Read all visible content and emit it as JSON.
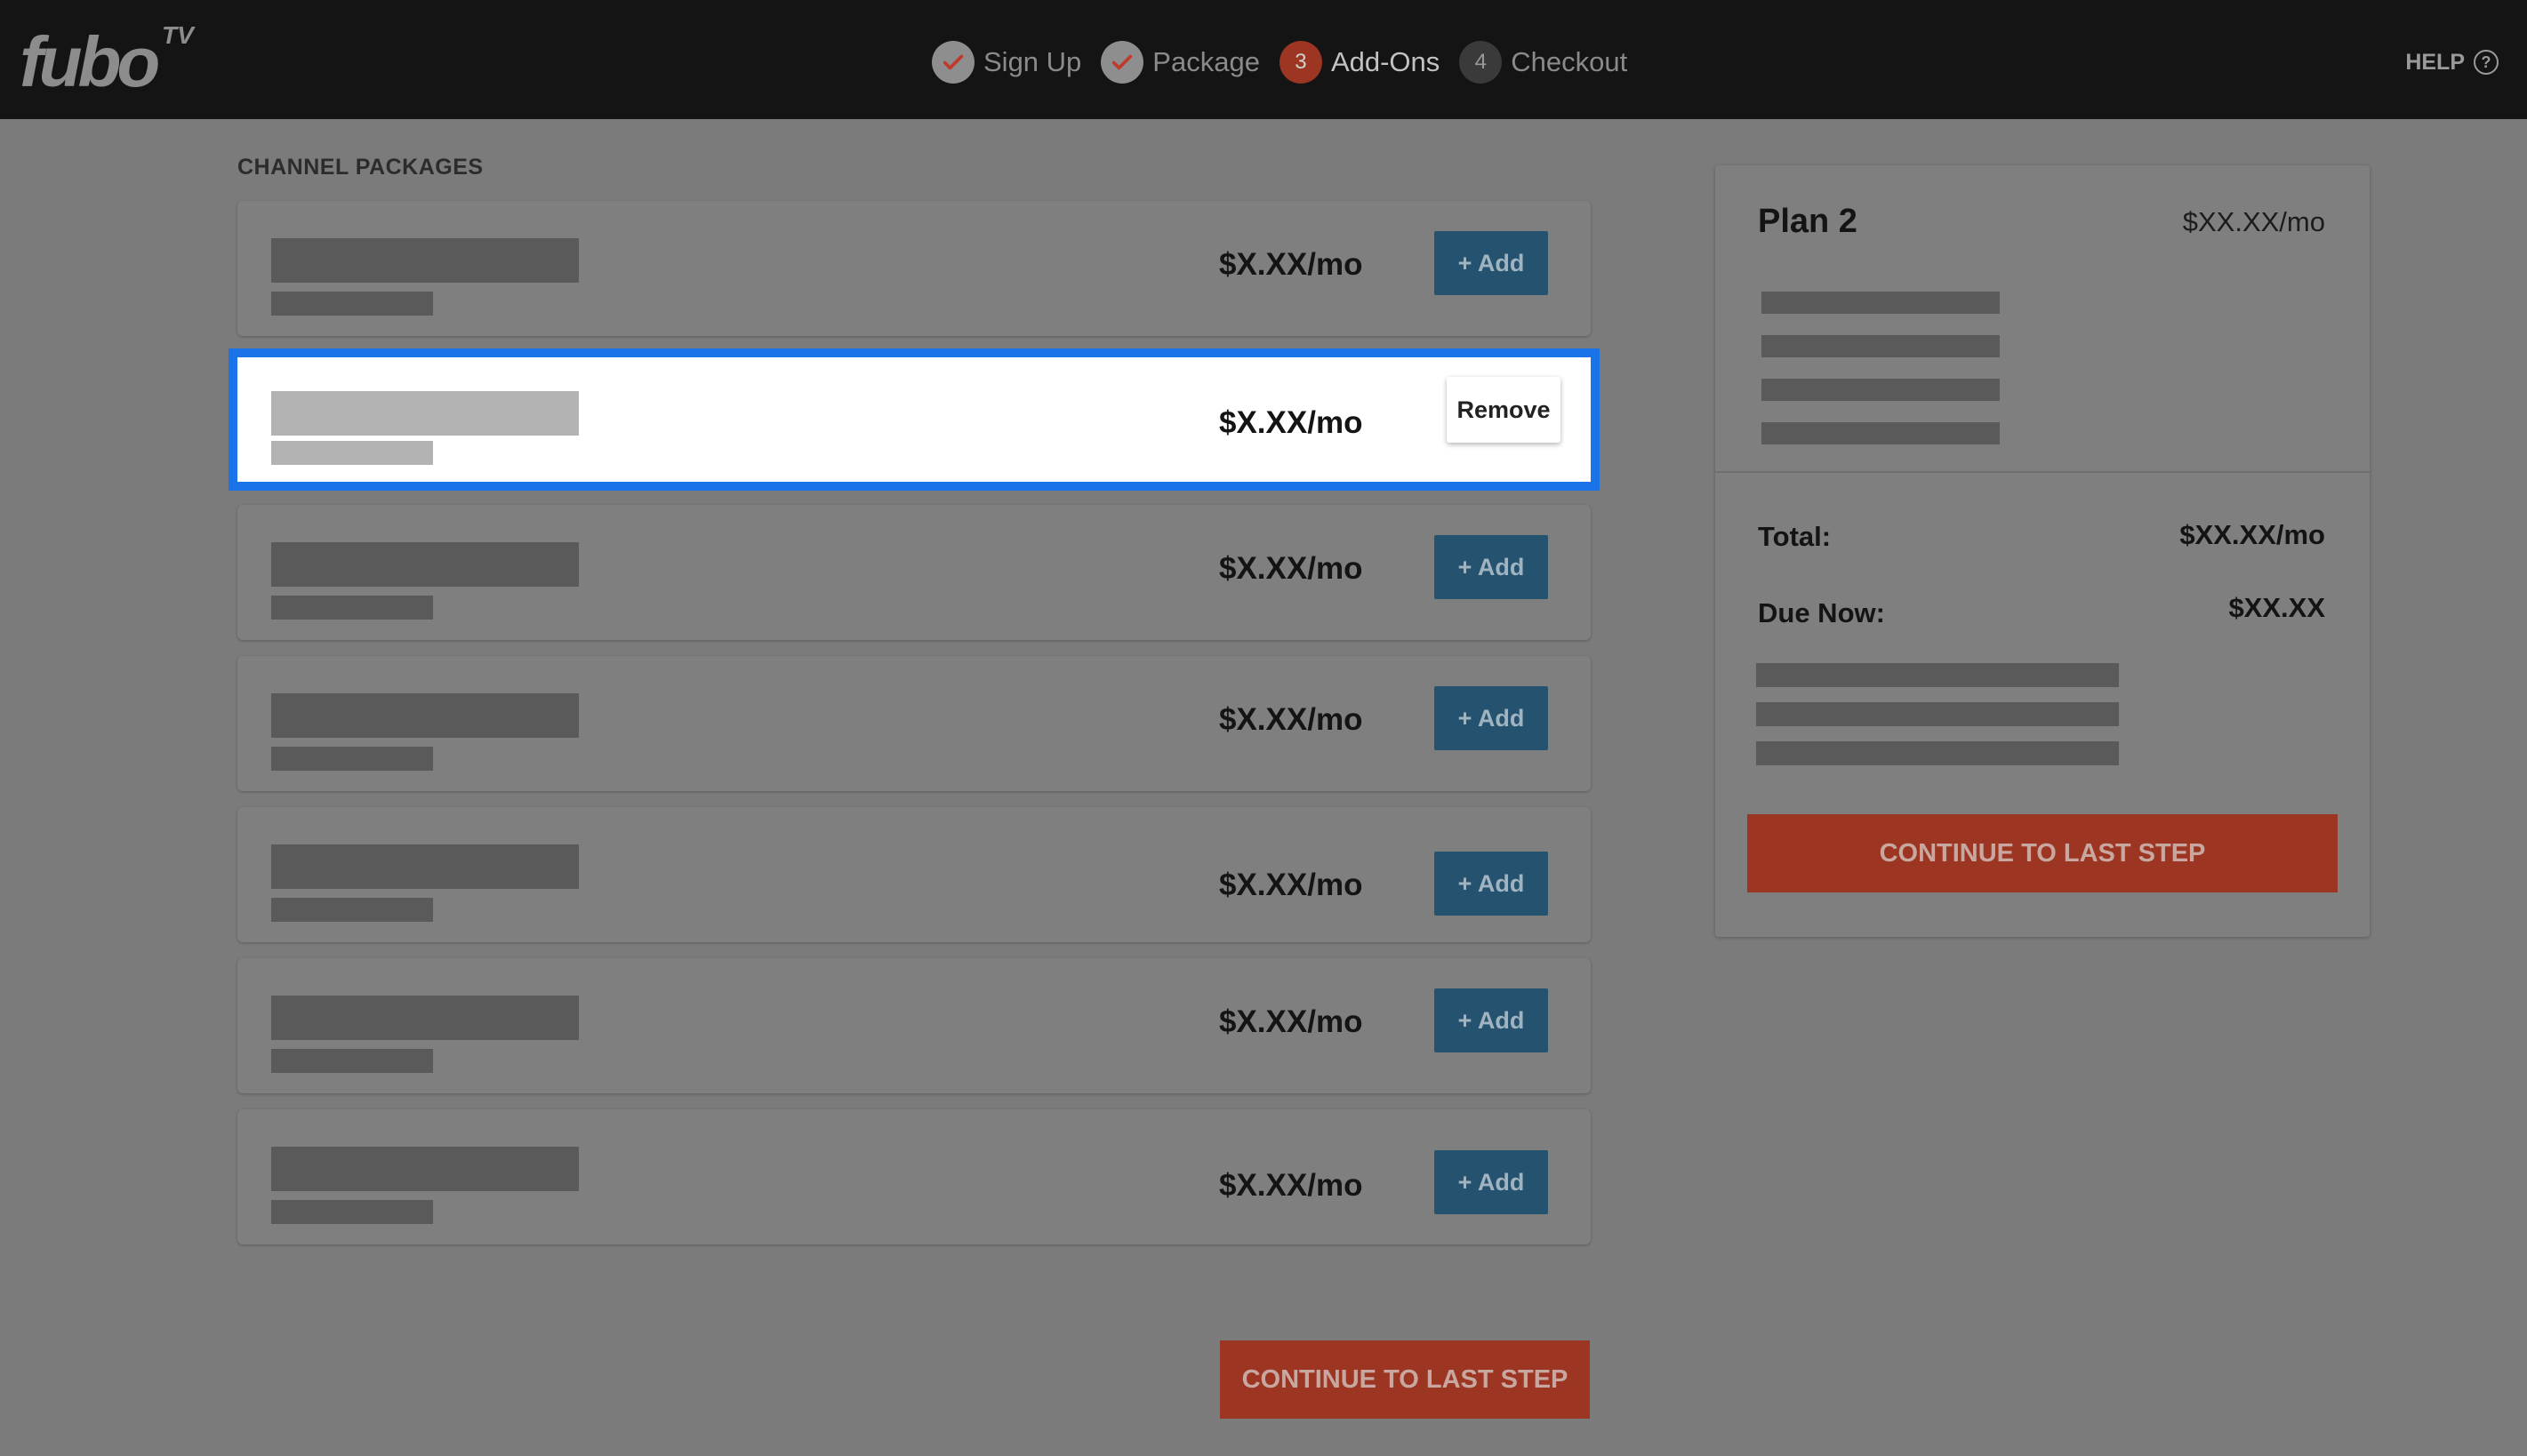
{
  "header": {
    "logo_text": "fubo",
    "logo_superscript": "TV",
    "steps": [
      {
        "number": "",
        "label": "Sign Up",
        "state": "done",
        "icon": "checkmark-icon"
      },
      {
        "number": "",
        "label": "Package",
        "state": "done",
        "icon": "checkmark-icon"
      },
      {
        "number": "3",
        "label": "Add-Ons",
        "state": "current"
      },
      {
        "number": "4",
        "label": "Checkout",
        "state": "pending"
      }
    ],
    "help_label": "HELP",
    "help_icon": "question-circle-icon"
  },
  "main": {
    "section_title": "CHANNEL PACKAGES",
    "packages": [
      {
        "price": "$X.XX/mo",
        "action": "+ Add",
        "selected": false
      },
      {
        "price": "$X.XX/mo",
        "action": "Remove",
        "selected": true
      },
      {
        "price": "$X.XX/mo",
        "action": "+ Add",
        "selected": false
      },
      {
        "price": "$X.XX/mo",
        "action": "+ Add",
        "selected": false
      },
      {
        "price": "$X.XX/mo",
        "action": "+ Add",
        "selected": false
      },
      {
        "price": "$X.XX/mo",
        "action": "+ Add",
        "selected": false
      },
      {
        "price": "$X.XX/mo",
        "action": "+ Add",
        "selected": false
      }
    ],
    "continue_label": "CONTINUE TO LAST STEP"
  },
  "summary": {
    "plan_name": "Plan 2",
    "plan_price": "$XX.XX/mo",
    "total_label": "Total:",
    "total_value": "$XX.XX/mo",
    "due_label": "Due Now:",
    "due_value": "$XX.XX",
    "continue_label": "CONTINUE TO LAST STEP"
  },
  "colors": {
    "accent_orange": "#9c3622",
    "add_button_blue": "#24526f",
    "selection_outline": "#1a73e8",
    "overlay_gray": "#7b7b7b"
  }
}
